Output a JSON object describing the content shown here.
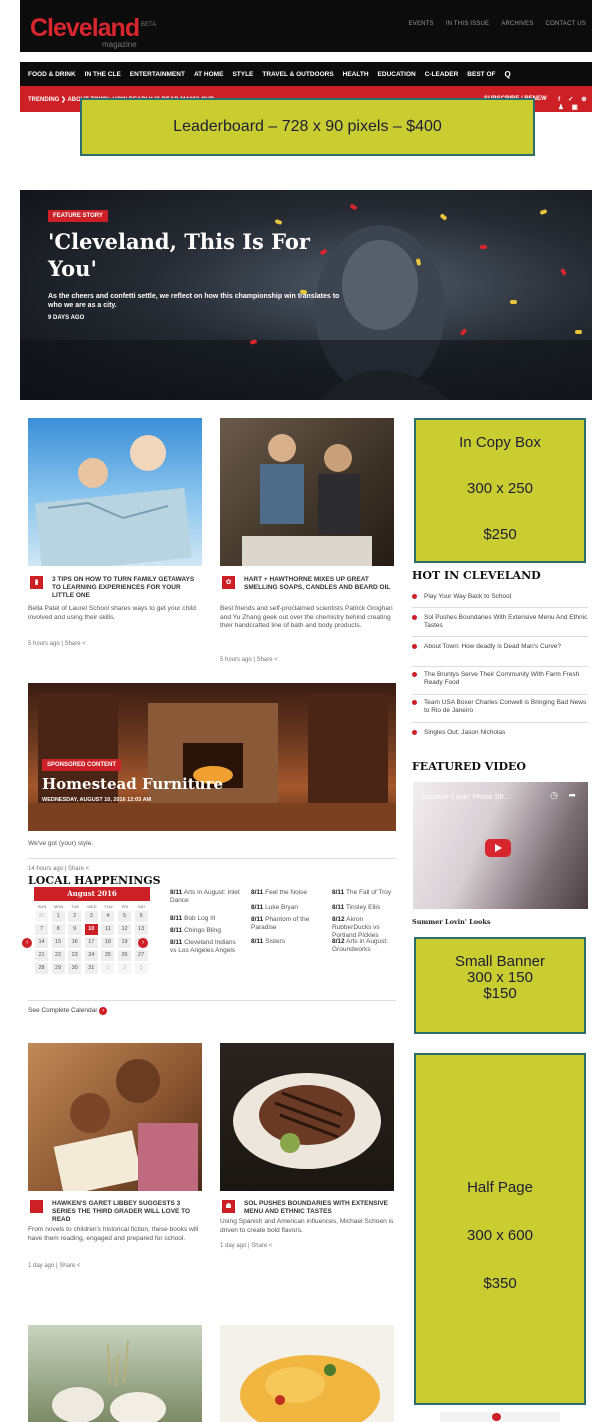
{
  "header": {
    "logo": "Cleveland",
    "logo_beta": "BETA",
    "logo_sub": "magazine",
    "top_links": [
      "EVENTS",
      "IN THIS ISSUE",
      "ARCHIVES",
      "CONTACT US"
    ],
    "nav": [
      "FOOD & DRINK",
      "IN THE CLE",
      "ENTERTAINMENT",
      "AT HOME",
      "STYLE",
      "TRAVEL & OUTDOORS",
      "HEALTH",
      "EDUCATION",
      "C-LEADER",
      "BEST OF"
    ],
    "search_icon": "Q",
    "trending": "TRENDING ❯ ABOUT TOWN: HOW DEADLY IS DEAD MAN'S CUR...",
    "subscribe": "SUBSCRIBE / RENEW",
    "social": "f ✓ ⊕ ♟ ▣"
  },
  "ads": {
    "leaderboard": "Leaderboard – 728 x 90 pixels – $400",
    "in_copy": [
      "In Copy Box",
      "300 x 250",
      "$250"
    ],
    "small_banner": [
      "Small Banner",
      "300 x 150",
      "$150"
    ],
    "half_page": [
      "Half Page",
      "300 x 600",
      "$350"
    ]
  },
  "hero": {
    "tag": "FEATURE STORY",
    "title": "'Cleveland, This Is For You'",
    "desc": "As the cheers and confetti settle, we reflect on how this championship win translates to who we are as a city.",
    "date": "9 DAYS AGO"
  },
  "cards": [
    {
      "title": "3 TIPS ON HOW TO TURN FAMILY GETAWAYS TO LEARNING EXPERIENCES FOR YOUR LITTLE ONE",
      "body": "Bella Patel of Laurel School shares ways to get your child involved and using their skills.",
      "meta": "5 hours ago | Share <",
      "icon": "▮"
    },
    {
      "title": "HART + HAWTHORNE MIXES UP GREAT SMELLING SOAPS, CANDLES AND BEARD OIL",
      "body": "Best friends and self-proclaimed scientists Patrick Groghan and Yu Zhang geek out over the chemistry behind creating their handcrafted line of bath and body products.",
      "meta": "5 hours ago | Share <",
      "icon": "✿"
    },
    {
      "title": "HAWKEN'S GARET LIBBEY SUGGESTS 3 SERIES THE THIRD GRADER WILL LOVE TO READ",
      "body": "From novels to children's historical fiction, these books will have them reading, engaged and prepared for school.",
      "meta": "1 day ago | Share <",
      "icon": ""
    },
    {
      "title": "SOL PUSHES BOUNDARIES WITH EXTENSIVE MENU AND ETHNIC TASTES",
      "body": "Using Spanish and American influences, Michael Schoen is driven to create bold flavors.",
      "meta": "1 day ago | Share <",
      "icon": "☗"
    }
  ],
  "sponsored": {
    "tag": "SPONSORED CONTENT",
    "title": "Homestead Furniture",
    "date": "WEDNESDAY, AUGUST 10, 2016 12:03 AM",
    "body": "We've got (your) style.",
    "meta": "14 hours ago | Share <"
  },
  "hot": {
    "heading": "HOT IN CLEVELAND",
    "items": [
      "Play Your Way Back to School",
      "Sol Pushes Boundaries With Extensive Menu And Ethnic Tastes",
      "About Town: How deadly is Dead Man's Curve?",
      "The Bruntys Serve Their Community With Farm Fresh Ready Food",
      "Team USA Boxer Charles Conwell is Bringing Bad News to Rio de Janeiro",
      "Singles Out: Jason Nicholas"
    ]
  },
  "video": {
    "heading": "FEATURED VIDEO",
    "title": "Summer Lovin' Photo Sh...",
    "caption": "Summer Lovin' Looks"
  },
  "happenings": {
    "heading": "LOCAL HAPPENINGS",
    "month": "August 2016",
    "dow": [
      "SUN",
      "MON",
      "TUE",
      "WED",
      "THU",
      "FRI",
      "SAT"
    ],
    "days": [
      "31",
      "1",
      "2",
      "3",
      "4",
      "5",
      "6",
      "7",
      "8",
      "9",
      "10",
      "11",
      "12",
      "13",
      "14",
      "15",
      "16",
      "17",
      "18",
      "19",
      "20",
      "21",
      "22",
      "23",
      "24",
      "25",
      "26",
      "27",
      "28",
      "29",
      "30",
      "31",
      "1",
      "2",
      "3"
    ],
    "selected": "10",
    "events": [
      {
        "date": "8/11",
        "name": "Arts in August: Inlet Dance"
      },
      {
        "date": "8/11",
        "name": "Bob Log III"
      },
      {
        "date": "8/11",
        "name": "Chingo Bling"
      },
      {
        "date": "8/11",
        "name": "Cleveland Indians vs Los Angeles Angels"
      },
      {
        "date": "8/11",
        "name": "Feel the Noise"
      },
      {
        "date": "8/11",
        "name": "Luke Bryan"
      },
      {
        "date": "8/11",
        "name": "Phantom of the Paradise"
      },
      {
        "date": "8/11",
        "name": "Sisters"
      },
      {
        "date": "8/11",
        "name": "The Fall of Troy"
      },
      {
        "date": "8/11",
        "name": "Tinsley Ellis"
      },
      {
        "date": "8/12",
        "name": "Akron RubberDucks vs Portland Pickles"
      },
      {
        "date": "8/12",
        "name": "Arts in August: Groundworks"
      }
    ],
    "see_all": "See Complete Calendar"
  }
}
